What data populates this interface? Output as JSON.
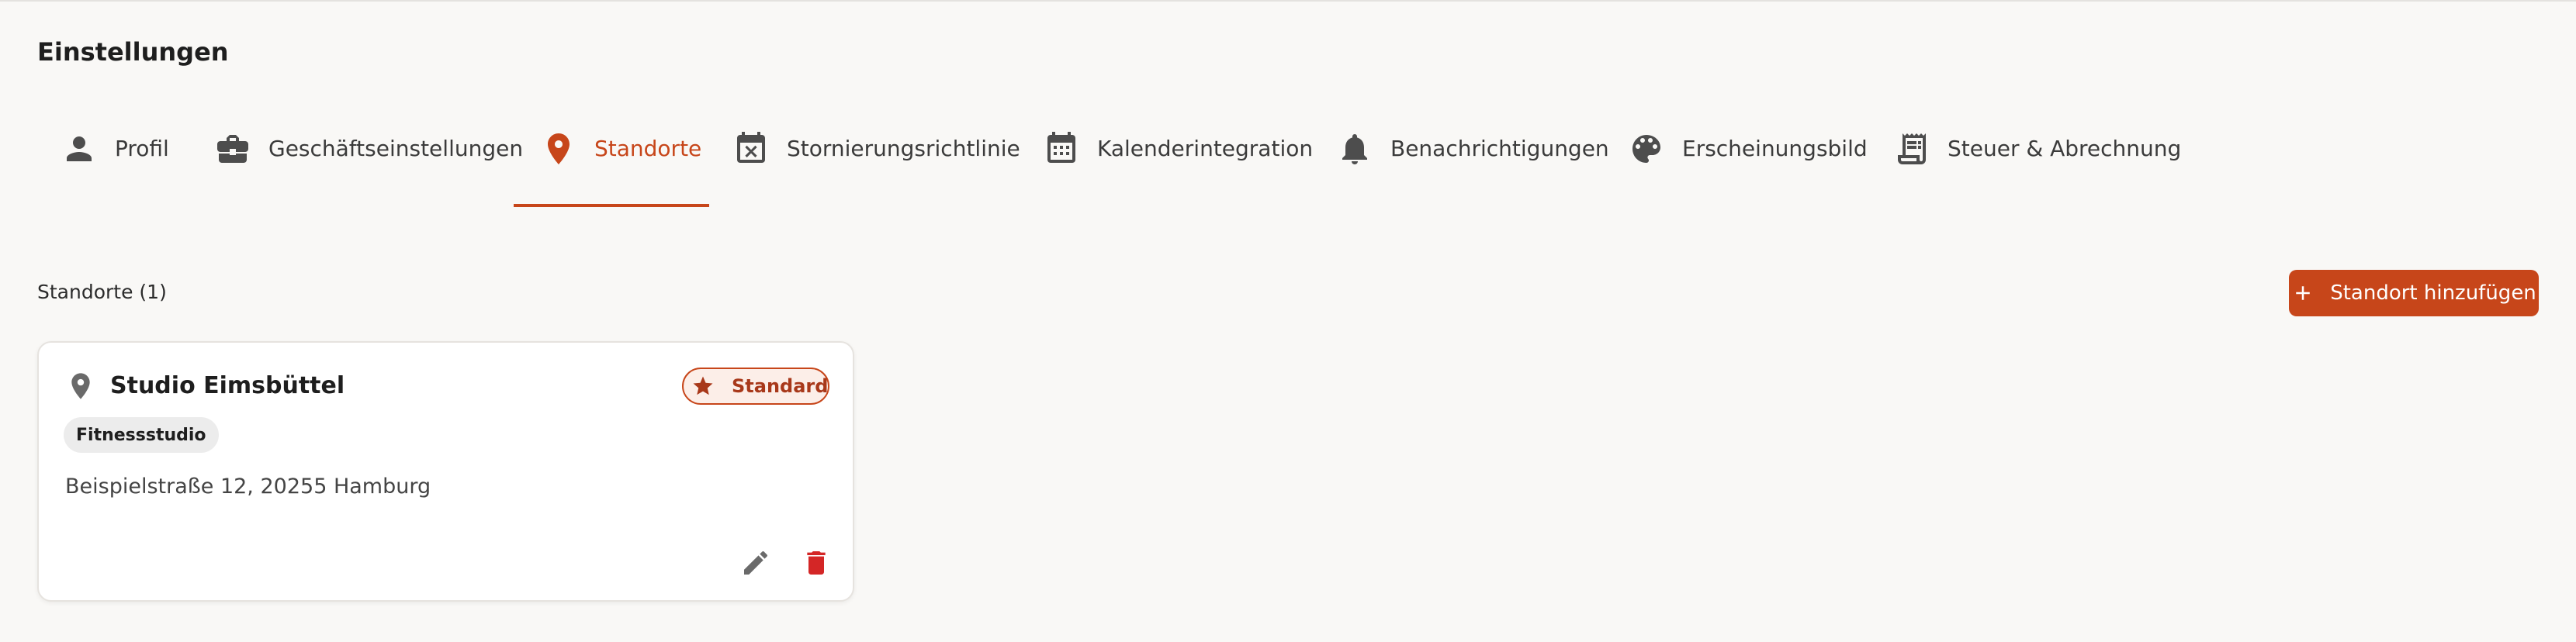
{
  "page": {
    "title": "Einstellungen"
  },
  "tabs": [
    {
      "label": "Profil",
      "icon": "person-icon"
    },
    {
      "label": "Geschäftseinstellungen",
      "icon": "briefcase-icon"
    },
    {
      "label": "Standorte",
      "icon": "location-pin-icon",
      "active": true
    },
    {
      "label": "Stornierungsrichtlinie",
      "icon": "calendar-cancel-icon"
    },
    {
      "label": "Kalenderintegration",
      "icon": "calendar-icon"
    },
    {
      "label": "Benachrichtigungen",
      "icon": "bell-icon"
    },
    {
      "label": "Erscheinungsbild",
      "icon": "palette-icon"
    },
    {
      "label": "Steuer & Abrechnung",
      "icon": "receipt-icon"
    }
  ],
  "locations": {
    "section_title": "Standorte (1)",
    "add_button_label": "Standort hinzufügen",
    "items": [
      {
        "name": "Studio Eimsbüttel",
        "badge": "Standard",
        "category": "Fitnessstudio",
        "address": "Beispielstraße 12, 20255 Hamburg"
      }
    ]
  },
  "colors": {
    "accent": "#c7461a",
    "delete": "#d42626",
    "background": "#f9f8f6"
  }
}
